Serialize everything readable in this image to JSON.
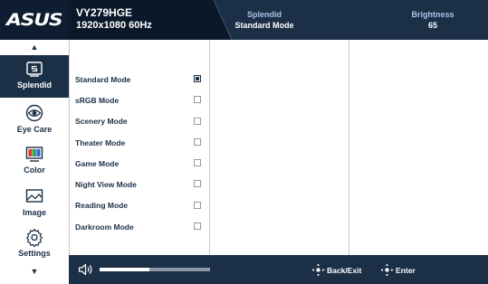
{
  "header": {
    "logo": "ASUS",
    "model": "VY279HGE",
    "resolution": "1920x1080 60Hz",
    "splendid_label": "Splendid",
    "splendid_value": "Standard Mode",
    "brightness_label": "Brightness",
    "brightness_value": "65"
  },
  "nav": {
    "items": [
      {
        "label": "Splendid",
        "icon": "splendid-icon",
        "active": true
      },
      {
        "label": "Eye Care",
        "icon": "eye-icon",
        "active": false
      },
      {
        "label": "Color",
        "icon": "color-icon",
        "active": false
      },
      {
        "label": "Image",
        "icon": "image-icon",
        "active": false
      },
      {
        "label": "Settings",
        "icon": "gear-icon",
        "active": false
      }
    ]
  },
  "menu": {
    "items": [
      {
        "label": "Standard Mode",
        "checked": true
      },
      {
        "label": "sRGB Mode",
        "checked": false
      },
      {
        "label": "Scenery Mode",
        "checked": false
      },
      {
        "label": "Theater Mode",
        "checked": false
      },
      {
        "label": "Game Mode",
        "checked": false
      },
      {
        "label": "Night View Mode",
        "checked": false
      },
      {
        "label": "Reading Mode",
        "checked": false
      },
      {
        "label": "Darkroom Mode",
        "checked": false
      }
    ]
  },
  "footer": {
    "volume_fraction": 0.45,
    "back_label": "Back/Exit",
    "enter_label": "Enter"
  },
  "colors": {
    "header_bg": "#1b2f47",
    "accent_text": "#a8c6e6",
    "nav_active": "#1b2f47"
  }
}
